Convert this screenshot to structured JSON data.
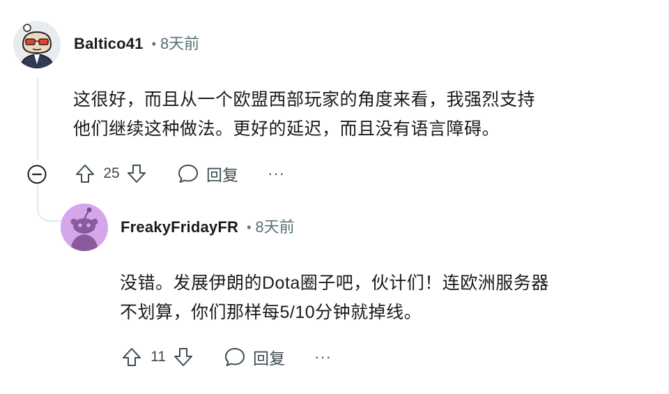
{
  "comments": [
    {
      "username": "Baltico41",
      "separator": "•",
      "time": "8天前",
      "body_lines": [
        "这很好，而且从一个欧盟西部玩家的角度来看，我强烈支持",
        "他们继续这种做法。更好的延迟，而且没有语言障碍。"
      ],
      "votes": "25",
      "reply_label": "回复",
      "more_label": "···",
      "avatar_icon": "snoo-glasses-avatar"
    },
    {
      "username": "FreakyFridayFR",
      "separator": "•",
      "time": "8天前",
      "body_lines": [
        "没错。发展伊朗的Dota圈子吧，伙计们！连欧洲服务器",
        "不划算，你们那样每5/10分钟就掉线。"
      ],
      "votes": "11",
      "reply_label": "回复",
      "more_label": "···",
      "avatar_icon": "snoo-default-avatar"
    }
  ],
  "colors": {
    "text": "#1a1a1b",
    "meta": "#576f76",
    "thread_line": "#e5e7ea",
    "avatar2_bg": "#d6a6ea"
  },
  "icons": {
    "upvote": "arrow-up-icon",
    "downvote": "arrow-down-icon",
    "reply": "speech-bubble-icon",
    "collapse": "minus-circle-icon"
  }
}
